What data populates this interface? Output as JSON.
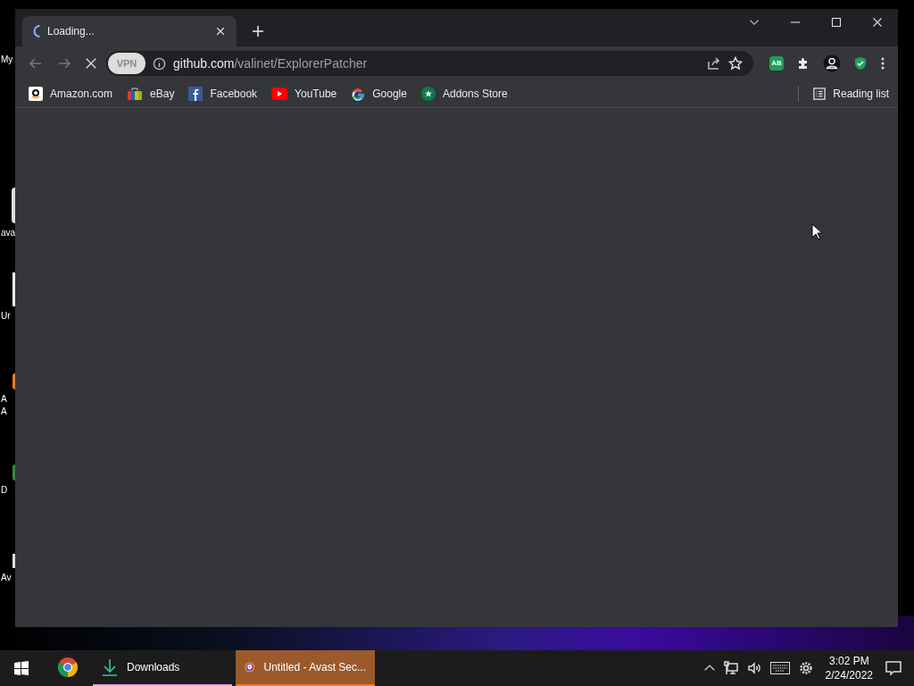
{
  "desktop_icons": [
    {
      "label": "My"
    },
    {
      "label": "ava"
    },
    {
      "label": "Ur"
    },
    {
      "label": "A\nA"
    },
    {
      "label": "D"
    },
    {
      "label": "Av"
    }
  ],
  "browser": {
    "tabs": [
      {
        "title": "Loading...",
        "selected": true,
        "loading": true
      }
    ],
    "toolbar": {
      "back_disabled": true,
      "forward_disabled": true,
      "vpn": "VPN",
      "url_host": "github.com",
      "url_path": "/valinet/ExplorerPatcher",
      "extension_badge": "AB"
    },
    "bookmarks": [
      {
        "label": "Amazon.com"
      },
      {
        "label": "eBay"
      },
      {
        "label": "Facebook"
      },
      {
        "label": "YouTube"
      },
      {
        "label": "Google"
      },
      {
        "label": "Addons Store"
      }
    ],
    "reading_list": "Reading list"
  },
  "taskbar": {
    "items": [
      {
        "kind": "icon",
        "selected": false,
        "open": false
      },
      {
        "kind": "labeled",
        "label": "Downloads",
        "selected": false,
        "open": true
      },
      {
        "kind": "labeled",
        "label": "Untitled - Avast Sec...",
        "selected": true,
        "open": true
      }
    ],
    "time": "3:02 PM",
    "date": "2/24/2022"
  }
}
